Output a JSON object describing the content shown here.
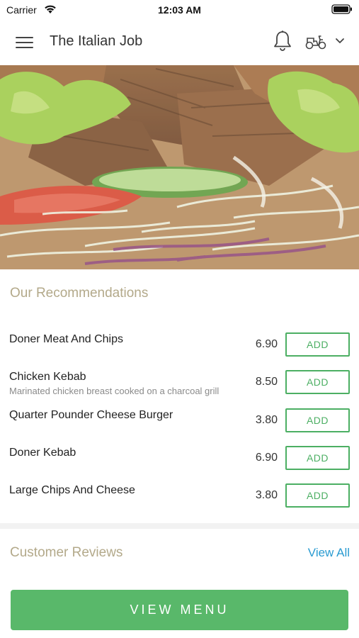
{
  "status_bar": {
    "carrier": "Carrier",
    "time": "12:03 AM"
  },
  "header": {
    "title": "The Italian Job"
  },
  "recommendations": {
    "title": "Our Recommendations",
    "items": [
      {
        "name": "Doner Meat And Chips",
        "description": "",
        "price": "6.90",
        "button": "ADD"
      },
      {
        "name": "Chicken Kebab",
        "description": "Marinated chicken breast cooked on a charcoal grill",
        "price": "8.50",
        "button": "ADD"
      },
      {
        "name": "Quarter Pounder Cheese Burger",
        "description": "",
        "price": "3.80",
        "button": "ADD"
      },
      {
        "name": "Doner Kebab",
        "description": "",
        "price": "6.90",
        "button": "ADD"
      },
      {
        "name": "Large Chips And Cheese",
        "description": "",
        "price": "3.80",
        "button": "ADD"
      }
    ]
  },
  "reviews": {
    "title": "Customer Reviews",
    "view_all": "View All"
  },
  "footer": {
    "view_menu": "VIEW MENU"
  },
  "colors": {
    "accent_green": "#59b86a",
    "link_blue": "#2a9bd1",
    "section_title": "#b3a98a"
  }
}
